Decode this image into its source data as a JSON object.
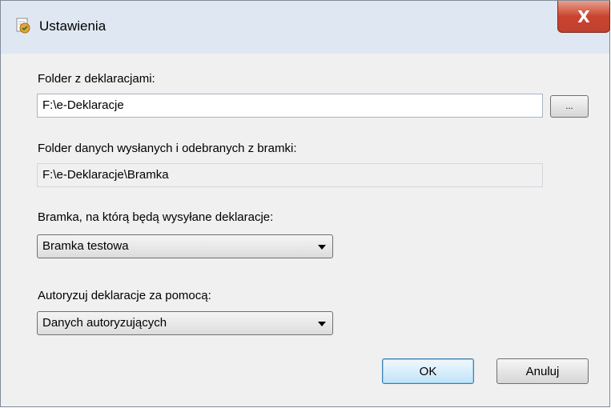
{
  "window": {
    "title": "Ustawienia",
    "close_label": "X"
  },
  "form": {
    "declarations_folder": {
      "label": "Folder z deklaracjami:",
      "value": "F:\\e-Deklaracje",
      "browse_label": "..."
    },
    "gateway_folder": {
      "label": "Folder danych wysłanych i odebranych z bramki:",
      "value": "F:\\e-Deklaracje\\Bramka"
    },
    "gateway": {
      "label": "Bramka, na którą będą wysyłane deklaracje:",
      "selected": "Bramka testowa"
    },
    "authorization": {
      "label": "Autoryzuj deklaracje za pomocą:",
      "selected": "Danych autoryzujących"
    }
  },
  "buttons": {
    "ok_label": "OK",
    "cancel_label": "Anuluj"
  }
}
